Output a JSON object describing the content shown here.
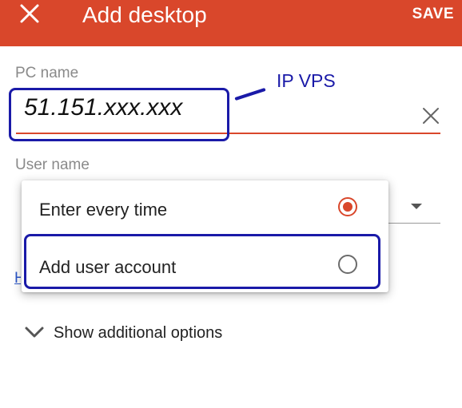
{
  "appbar": {
    "title": "Add desktop",
    "save_label": "SAVE",
    "close_icon": "close-icon",
    "background_color": "#d9472b"
  },
  "pc_name": {
    "label": "PC name",
    "value": "51.151.xxx.xxx",
    "clear_icon": "clear-icon"
  },
  "annotation": {
    "text": "IP VPS",
    "color": "#1a1aa8"
  },
  "user_name": {
    "label": "User name"
  },
  "user_menu": {
    "options": [
      {
        "label": "Enter every time",
        "selected": true
      },
      {
        "label": "Add user account",
        "selected": false
      }
    ]
  },
  "more": {
    "label": "Show additional options",
    "icon": "chevron-down-icon"
  }
}
